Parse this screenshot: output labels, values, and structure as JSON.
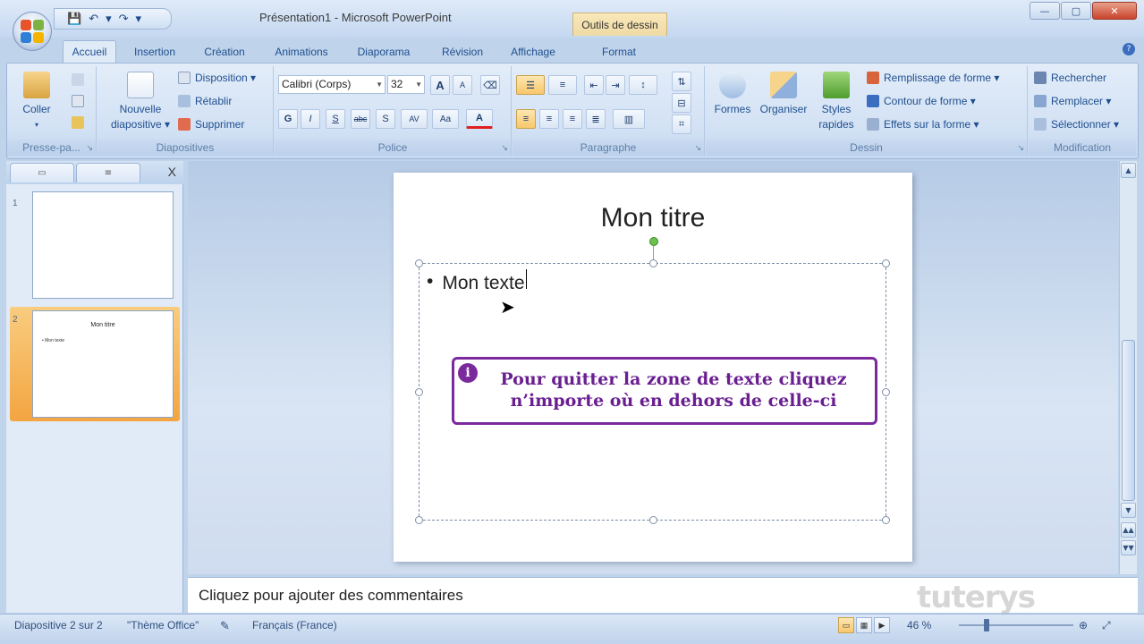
{
  "window": {
    "title": "Présentation1 - Microsoft PowerPoint",
    "context_tab_header": "Outils de dessin",
    "controls": {
      "minimize": "—",
      "maximize": "▢",
      "close": "✕"
    }
  },
  "quick_access": {
    "save": "💾",
    "undo": "↶",
    "undo_arrow": "▾",
    "redo": "↷",
    "customize": "▾"
  },
  "tabs": [
    {
      "label": "Accueil"
    },
    {
      "label": "Insertion"
    },
    {
      "label": "Création"
    },
    {
      "label": "Animations"
    },
    {
      "label": "Diaporama"
    },
    {
      "label": "Révision"
    },
    {
      "label": "Affichage"
    },
    {
      "label": "Format"
    }
  ],
  "help_icon": "?",
  "ribbon": {
    "clipboard": {
      "label": "Presse-pa...",
      "paste": "Coller",
      "paste_arrow": "▾"
    },
    "slides": {
      "label": "Diapositives",
      "new_slide": "Nouvelle diapositive ▾",
      "layout": "Disposition ▾",
      "reset": "Rétablir",
      "delete": "Supprimer"
    },
    "font": {
      "label": "Police",
      "font_name": "Calibri (Corps)",
      "font_size": "32",
      "grow": "A",
      "shrink": "A",
      "clear": "⌫",
      "bold": "G",
      "italic": "I",
      "underline": "S",
      "strike": "abc",
      "shadow": "S",
      "spacing": "AV",
      "case": "Aa",
      "color": "A"
    },
    "paragraph": {
      "label": "Paragraphe"
    },
    "drawing": {
      "label": "Dessin",
      "shapes": "Formes",
      "arrange": "Organiser",
      "quick_styles": "Styles rapides",
      "fill": "Remplissage de forme ▾",
      "outline": "Contour de forme ▾",
      "effects": "Effets sur la forme ▾"
    },
    "editing": {
      "label": "Modification",
      "find": "Rechercher",
      "replace": "Remplacer ▾",
      "select": "Sélectionner ▾"
    },
    "launcher": "↘"
  },
  "slides_pane": {
    "close": "X",
    "slides": [
      {
        "number": "1",
        "title": "",
        "text": ""
      },
      {
        "number": "2",
        "title": "Mon titre",
        "text": "• Mon texte"
      }
    ]
  },
  "slide": {
    "title": "Mon titre",
    "bullet": "•",
    "body_text": "Mon texte",
    "hint_icon": "i",
    "hint_line1": "Pour quitter la zone de texte cliquez",
    "hint_line2": "n’importe où en dehors de celle-ci"
  },
  "cursor": "➤",
  "notes": {
    "placeholder": "Cliquez pour ajouter des commentaires"
  },
  "watermark": "tuterys",
  "scrollbar": {
    "up": "▲",
    "down": "▼",
    "prev": "▲▲",
    "next": "▼▼"
  },
  "statusbar": {
    "slide_info": "Diapositive 2 sur 2",
    "theme": "\"Thème Office\"",
    "language": "Français (France)",
    "zoom": "46 %"
  }
}
